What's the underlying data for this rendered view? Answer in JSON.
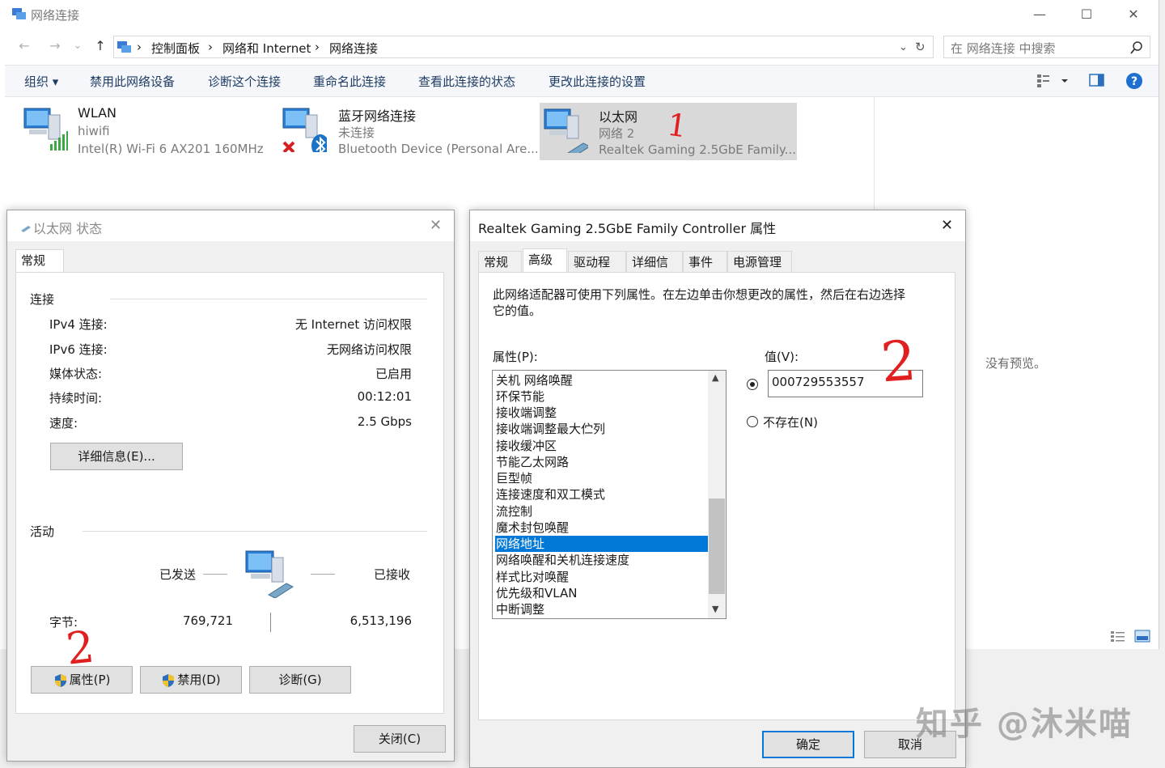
{
  "explorer": {
    "title": "网络连接",
    "nav": {
      "back": "←",
      "forward": "→",
      "recent": "⌄",
      "up": "↑"
    },
    "breadcrumb": [
      "控制面板",
      "网络和 Internet",
      "网络连接"
    ],
    "search_placeholder": "在 网络连接 中搜索",
    "commands": [
      "组织",
      "禁用此网络设备",
      "诊断这个连接",
      "重命名此连接",
      "查看此连接的状态",
      "更改此连接的设置"
    ],
    "connections": [
      {
        "name": "WLAN",
        "status": "hiwifi",
        "device": "Intel(R) Wi-Fi 6 AX201 160MHz"
      },
      {
        "name": "蓝牙网络连接",
        "status": "未连接",
        "device": "Bluetooth Device (Personal Are..."
      },
      {
        "name": "以太网",
        "status": "网络 2",
        "device": "Realtek Gaming 2.5GbE Family..."
      }
    ],
    "preview_text": "没有预览。",
    "accent_color": "#0078d7"
  },
  "status_dialog": {
    "title": "以太网 状态",
    "tab": "常规",
    "section_connection": "连接",
    "rows": [
      {
        "label": "IPv4 连接:",
        "value": "无 Internet 访问权限"
      },
      {
        "label": "IPv6 连接:",
        "value": "无网络访问权限"
      },
      {
        "label": "媒体状态:",
        "value": "已启用"
      },
      {
        "label": "持续时间:",
        "value": "00:12:01"
      },
      {
        "label": "速度:",
        "value": "2.5 Gbps"
      }
    ],
    "details_button": "详细信息(E)...",
    "section_activity": "活动",
    "sent_label": "已发送",
    "received_label": "已接收",
    "bytes_label": "字节:",
    "bytes_sent": "769,721",
    "bytes_received": "6,513,196",
    "buttons": {
      "properties": "属性(P)",
      "disable": "禁用(D)",
      "diagnose": "诊断(G)",
      "close": "关闭(C)"
    },
    "annotation": "2"
  },
  "props_dialog": {
    "title": "Realtek Gaming 2.5GbE Family Controller 属性",
    "tabs": [
      "常规",
      "高级",
      "驱动程序",
      "详细信息",
      "事件",
      "电源管理"
    ],
    "active_tab": "高级",
    "description": "此网络适配器可使用下列属性。在左边单击你想更改的属性，然后在右边选择它的值。",
    "property_label": "属性(P):",
    "value_label": "值(V):",
    "properties": [
      "关机 网络唤醒",
      "环保节能",
      "接收端调整",
      "接收端调整最大伫列",
      "接收缓冲区",
      "节能乙太网路",
      "巨型帧",
      "连接速度和双工模式",
      "流控制",
      "魔术封包唤醒",
      "网络地址",
      "网络唤醒和关机连接速度",
      "样式比对唤醒",
      "优先级和VLAN",
      "中断调整"
    ],
    "selected_property": "网络地址",
    "value": "000729553557",
    "not_present_label": "不存在(N)",
    "ok": "确定",
    "cancel": "取消",
    "annotation": "2"
  },
  "annotation_explorer": "1",
  "watermark": "知乎 @沐米喵"
}
